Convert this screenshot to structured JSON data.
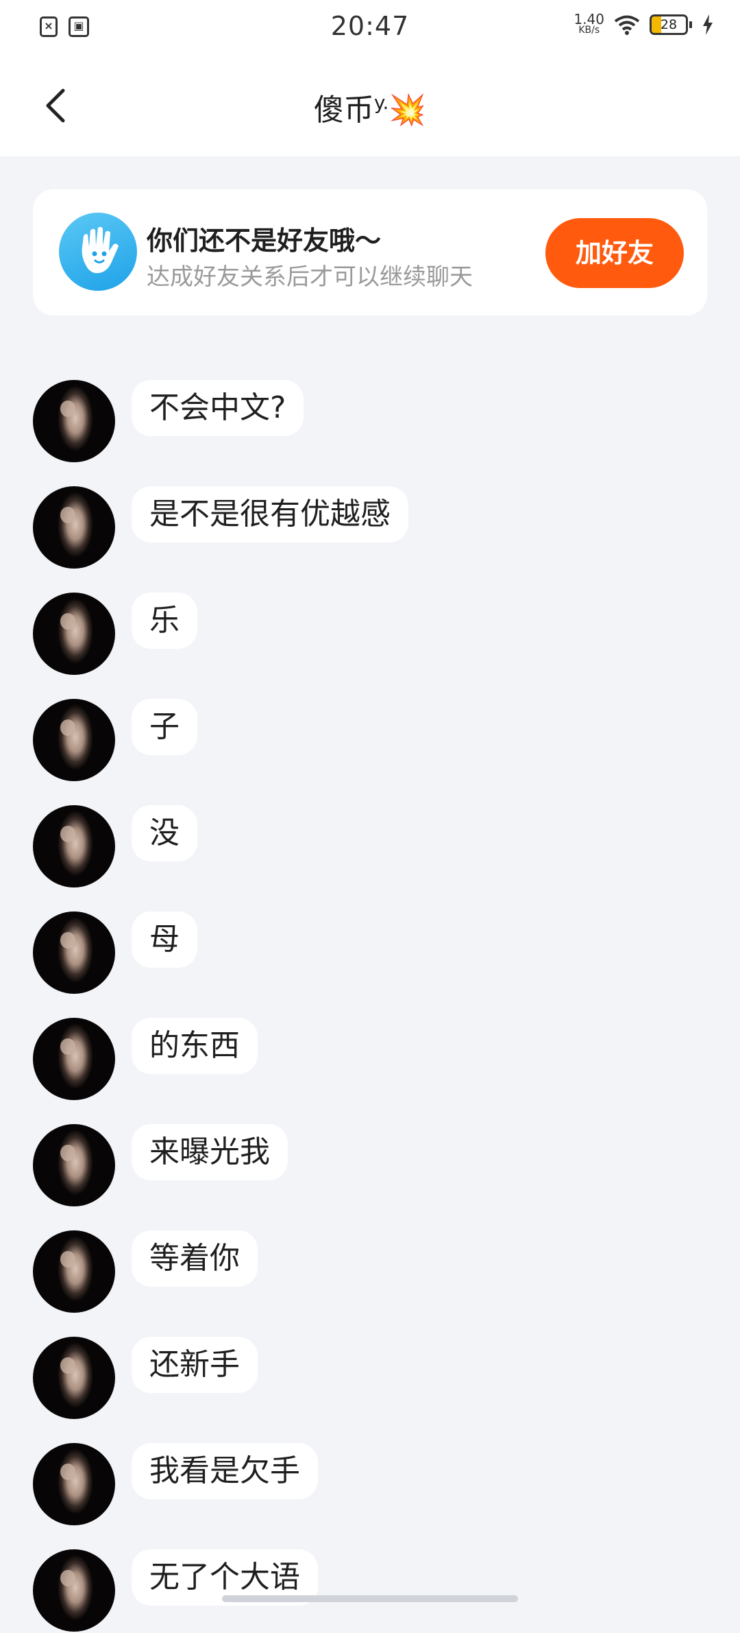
{
  "status_bar": {
    "time": "20:47",
    "net_speed_value": "1.40",
    "net_speed_unit": "KB/s",
    "battery_level": "28",
    "left_icons": [
      "sim-error-icon",
      "screen-recording-icon"
    ],
    "right_icons": [
      "wifi-icon",
      "battery-icon",
      "charging-icon"
    ]
  },
  "header": {
    "title": "傻币",
    "title_sup": "y.",
    "title_emoji": "💥"
  },
  "friend_prompt": {
    "title": "你们还不是好友哦～",
    "subtitle": "达成好友关系后才可以继续聊天",
    "button_label": "加好友",
    "accent_color": "#FF5A0E"
  },
  "messages": [
    {
      "text": "不会中文?"
    },
    {
      "text": "是不是很有优越感"
    },
    {
      "text": "乐"
    },
    {
      "text": "子"
    },
    {
      "text": "没"
    },
    {
      "text": "母"
    },
    {
      "text": "的东西"
    },
    {
      "text": "来曝光我"
    },
    {
      "text": "等着你"
    },
    {
      "text": "还新手"
    },
    {
      "text": "我看是欠手"
    },
    {
      "text": "无了个大语"
    }
  ]
}
